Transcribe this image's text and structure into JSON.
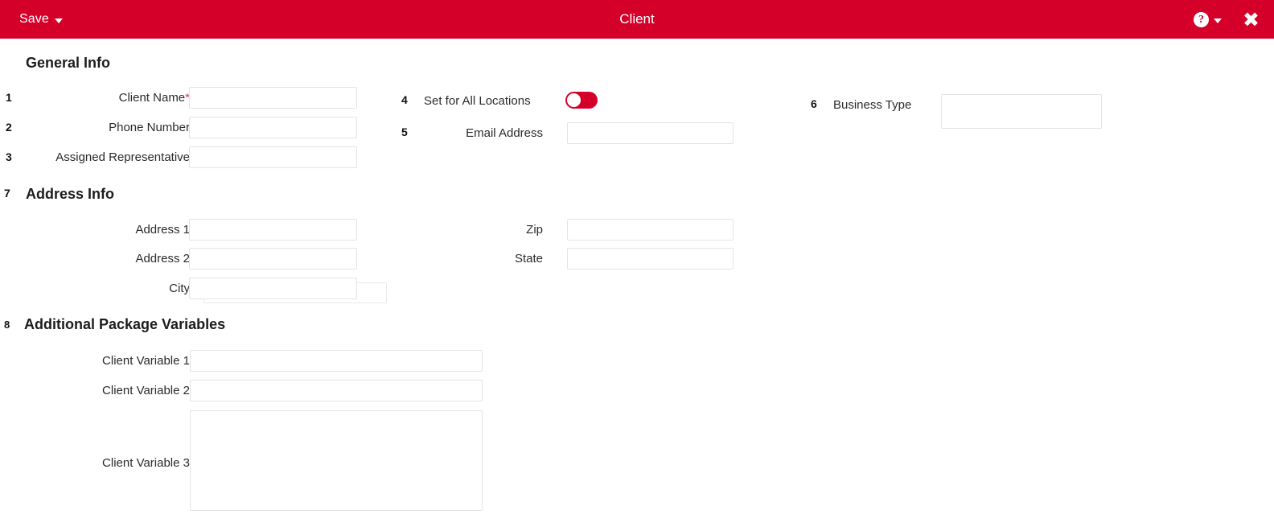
{
  "titlebar": {
    "save_label": "Save",
    "title": "Client",
    "help_icon": "help-circle-icon",
    "help_caret": "chevron-down-icon",
    "close_icon": "close-icon",
    "bar_color": "#d5002a"
  },
  "sections": {
    "general": {
      "title": "General Info",
      "marker": ""
    },
    "address": {
      "title": "Address Info",
      "marker": "7"
    },
    "additional": {
      "title": "Additional Package Variables",
      "marker": "8"
    }
  },
  "fields": {
    "client_name": {
      "marker": "1",
      "label": "Client Name",
      "required_star": "*",
      "value": "",
      "placeholder": ""
    },
    "phone_number": {
      "marker": "2",
      "label": "Phone Number",
      "value": "",
      "placeholder": ""
    },
    "assigned_representative": {
      "marker": "3",
      "label": "Assigned Representative",
      "value": "",
      "placeholder": ""
    },
    "set_for_all_locations": {
      "marker": "4",
      "label": "Set for All Locations",
      "state": "off",
      "color": "#d5002a"
    },
    "email_address": {
      "marker": "5",
      "label": "Email Address",
      "value": "",
      "placeholder": ""
    },
    "business_type": {
      "marker": "6",
      "label": "Business Type",
      "value": "",
      "placeholder": ""
    },
    "address_1": {
      "label": "Address 1",
      "value": "",
      "placeholder": ""
    },
    "address_2": {
      "label": "Address 2",
      "value": "",
      "placeholder": ""
    },
    "city": {
      "label": "City",
      "value": "",
      "placeholder": ""
    },
    "zip": {
      "label": "Zip",
      "value": "",
      "placeholder": ""
    },
    "state": {
      "label": "State",
      "value": "",
      "placeholder": ""
    },
    "client_variable_1": {
      "label": "Client Variable 1",
      "value": "",
      "placeholder": ""
    },
    "client_variable_2": {
      "label": "Client Variable 2",
      "value": "",
      "placeholder": ""
    },
    "client_variable_3": {
      "label": "Client Variable 3",
      "value": "",
      "placeholder": ""
    }
  }
}
